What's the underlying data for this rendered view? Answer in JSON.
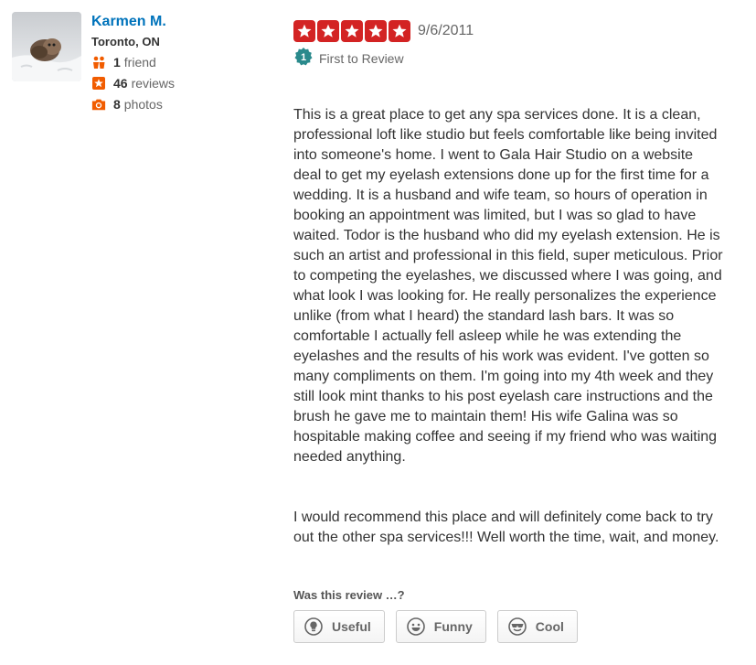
{
  "user": {
    "name": "Karmen M.",
    "location": "Toronto, ON",
    "friends": {
      "count": "1",
      "label": "friend",
      "icon": "friends-icon"
    },
    "reviews": {
      "count": "46",
      "label": "reviews",
      "icon": "star-icon"
    },
    "photos": {
      "count": "8",
      "label": "photos",
      "icon": "camera-icon"
    }
  },
  "review": {
    "rating": 5,
    "rating_max": 5,
    "date": "9/6/2011",
    "badge": {
      "number": "1",
      "label": "First to Review"
    },
    "paragraphs": [
      "This is a great place to get any spa services done. It is a clean, professional loft like studio but feels comfortable like being invited into someone's home.  I went to Gala Hair Studio on a website deal to get my eyelash extensions done up for the first time for a wedding.  It is a husband and wife team, so hours of operation in booking an appointment was limited, but I was so glad to have waited.  Todor is the husband who did my eyelash extension. He is such an artist and professional in this field, super meticulous.  Prior to competing the eyelashes, we discussed where I was going, and what look I was looking for. He really personalizes the experience unlike (from what I heard) the standard lash bars.  It was so comfortable I actually fell asleep while he was extending the eyelashes and the results of his work was evident.  I've gotten so many compliments on them. I'm going into my 4th week and they still look mint thanks to his post eyelash care instructions and the brush he gave me to maintain them! His wife Galina was so hospitable making coffee and seeing if my friend who was waiting needed anything.",
      "I would recommend this place and will definitely come back to try out the other spa services!!! Well worth the time, wait, and money."
    ]
  },
  "votes": {
    "prompt": "Was this review …?",
    "useful": "Useful",
    "funny": "Funny",
    "cool": "Cool"
  },
  "colors": {
    "link": "#0073bb",
    "star": "#d32323",
    "badge": "#41a700",
    "accent_orange": "#f15c00"
  }
}
